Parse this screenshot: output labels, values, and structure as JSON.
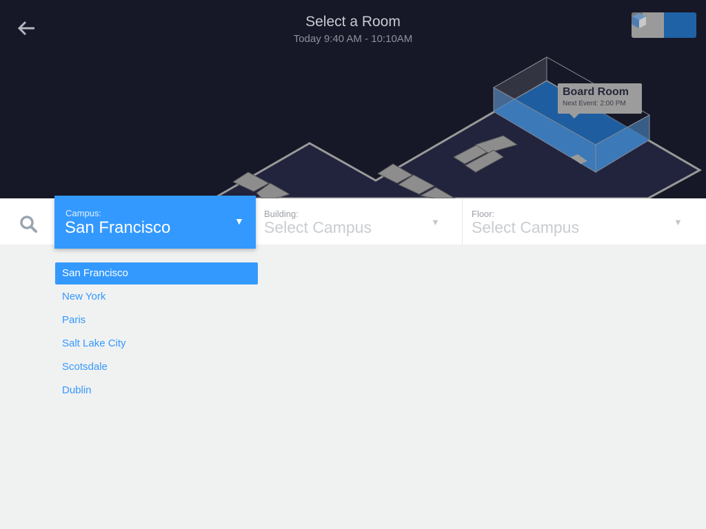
{
  "header": {
    "title": "Select a Room",
    "subtitle": "Today 9:40 AM - 10:10AM"
  },
  "view_toggle": {
    "options": [
      "2d-view",
      "3d-view"
    ],
    "selected": "3d-view"
  },
  "map": {
    "room_tooltip": {
      "name": "Board Room",
      "next_event": "Next Event: 2:00 PM"
    },
    "highlight_color": "#1f62a6"
  },
  "filters": {
    "campus": {
      "label": "Campus:",
      "value": "San Francisco"
    },
    "building": {
      "label": "Building:",
      "value": "Select Campus"
    },
    "floor": {
      "label": "Floor:",
      "value": "Select Campus"
    }
  },
  "campus_options": [
    {
      "label": "San Francisco",
      "selected": true
    },
    {
      "label": "New York"
    },
    {
      "label": "Paris"
    },
    {
      "label": "Salt Lake City"
    },
    {
      "label": "Scotsdale"
    },
    {
      "label": "Dublin"
    }
  ],
  "colors": {
    "accent": "#3399fe",
    "map_bg": "#161827"
  }
}
